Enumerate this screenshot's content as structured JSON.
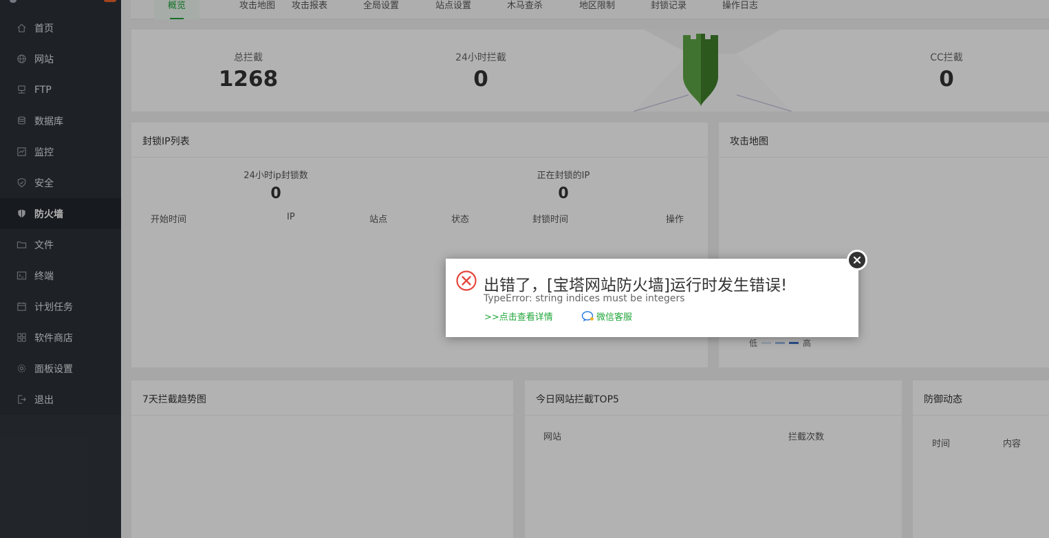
{
  "sidebar": {
    "items": [
      {
        "label": "首页",
        "icon": "home-icon"
      },
      {
        "label": "网站",
        "icon": "globe-icon"
      },
      {
        "label": "FTP",
        "icon": "ftp-icon"
      },
      {
        "label": "数据库",
        "icon": "database-icon"
      },
      {
        "label": "监控",
        "icon": "monitor-icon"
      },
      {
        "label": "安全",
        "icon": "shield-check-icon"
      },
      {
        "label": "防火墙",
        "icon": "firewall-shield-icon",
        "active": true
      },
      {
        "label": "文件",
        "icon": "folder-icon"
      },
      {
        "label": "终端",
        "icon": "terminal-icon"
      },
      {
        "label": "计划任务",
        "icon": "calendar-icon"
      },
      {
        "label": "软件商店",
        "icon": "apps-grid-icon"
      },
      {
        "label": "面板设置",
        "icon": "gear-icon"
      },
      {
        "label": "退出",
        "icon": "logout-icon"
      }
    ]
  },
  "tabs": [
    {
      "label": "概览",
      "active": true
    },
    {
      "label": "攻击地图"
    },
    {
      "label": "攻击报表"
    },
    {
      "label": "全局设置"
    },
    {
      "label": "站点设置"
    },
    {
      "label": "木马查杀"
    },
    {
      "label": "地区限制"
    },
    {
      "label": "封锁记录"
    },
    {
      "label": "操作日志"
    }
  ],
  "stats": {
    "total_label": "总拦截",
    "total_value": "1268",
    "day_label": "24小时拦截",
    "day_value": "0",
    "cc_label": "CC拦截",
    "cc_value": "0"
  },
  "ip_panel": {
    "title": "封锁IP列表",
    "blocked_24h_label": "24小时ip封锁数",
    "blocked_24h_value": "0",
    "blocking_now_label": "正在封锁的IP",
    "blocking_now_value": "0",
    "columns": [
      "开始时间",
      "IP",
      "站点",
      "状态",
      "封锁时间",
      "操作"
    ]
  },
  "map_panel": {
    "title": "攻击地图",
    "legend_low": "低",
    "legend_high": "高"
  },
  "trend_panel": {
    "title": "7天拦截趋势图"
  },
  "top5_panel": {
    "title": "今日网站拦截TOP5",
    "columns": [
      "网站",
      "拦截次数"
    ]
  },
  "defense_panel": {
    "title": "防御动态",
    "columns": [
      "时间",
      "内容"
    ]
  },
  "dialog": {
    "title": "出错了，[宝塔网站防火墙]运行时发生错误!",
    "message": "TypeError: string indices must be integers",
    "detail_link": ">>点击查看详情",
    "wechat_link": "微信客服"
  },
  "colors": {
    "sidebar_bg": "#2c3138",
    "accent_green": "#20a53a",
    "error_red": "#e5463c",
    "shield_green": "#4f9a38"
  }
}
